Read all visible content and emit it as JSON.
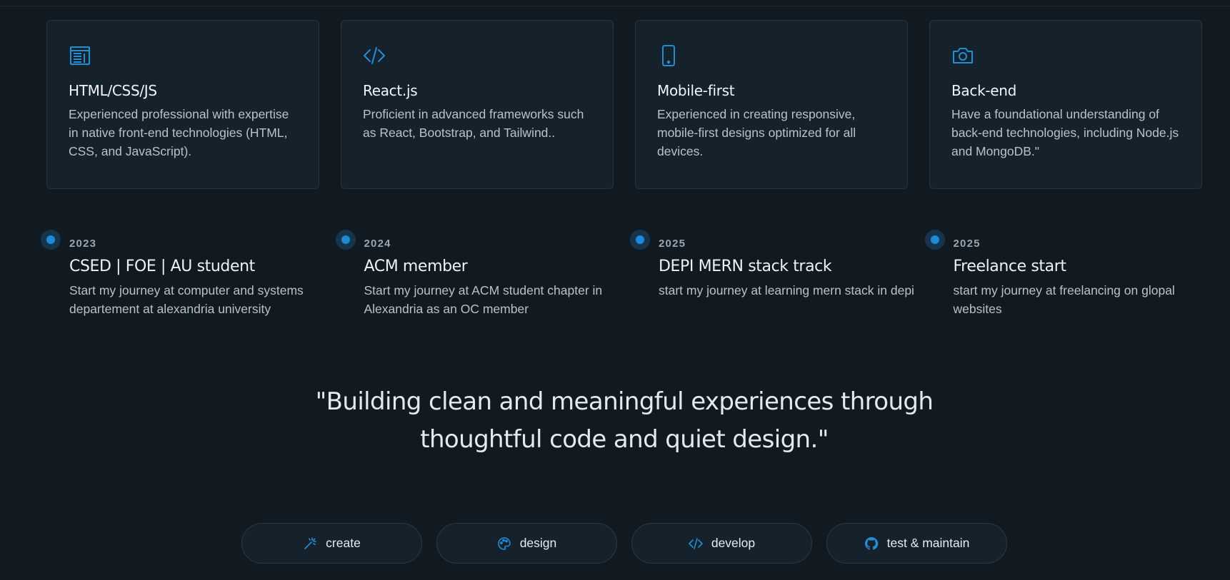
{
  "cards": [
    {
      "icon": "newspaper-icon",
      "title": "HTML/CSS/JS",
      "text": "Experienced professional with expertise in native front-end technologies (HTML, CSS, and JavaScript)."
    },
    {
      "icon": "code-icon",
      "title": "React.js",
      "text": "Proficient in advanced frameworks such as React, Bootstrap, and Tailwind.."
    },
    {
      "icon": "phone-icon",
      "title": "Mobile-first",
      "text": "Experienced in creating responsive, mobile-first designs optimized for all devices."
    },
    {
      "icon": "camera-icon",
      "title": "Back-end",
      "text": "Have a foundational understanding of back-end technologies, including Node.js and MongoDB.\""
    }
  ],
  "timeline": [
    {
      "year": "2023",
      "title": "CSED | FOE | AU student",
      "text": "Start my journey at computer and systems departement at alexandria university"
    },
    {
      "year": "2024",
      "title": "ACM member",
      "text": "Start my journey at ACM student chapter in Alexandria as an OC member"
    },
    {
      "year": "2025",
      "title": "DEPI MERN stack track",
      "text": "start my journey at learning mern stack in depi"
    },
    {
      "year": "2025",
      "title": "Freelance start",
      "text": "start my journey at freelancing on glopal websites"
    }
  ],
  "quote": {
    "line1": "\"Building clean and meaningful experiences through",
    "line2": "thoughtful code and quiet design.\""
  },
  "pills": [
    {
      "icon": "magic-wand-icon",
      "label": "create"
    },
    {
      "icon": "palette-icon",
      "label": "design"
    },
    {
      "icon": "code-icon",
      "label": "develop"
    },
    {
      "icon": "github-icon",
      "label": "test & maintain"
    }
  ],
  "colors": {
    "background": "#111a21",
    "card": "#16222b",
    "accent": "#1f8fd6"
  }
}
